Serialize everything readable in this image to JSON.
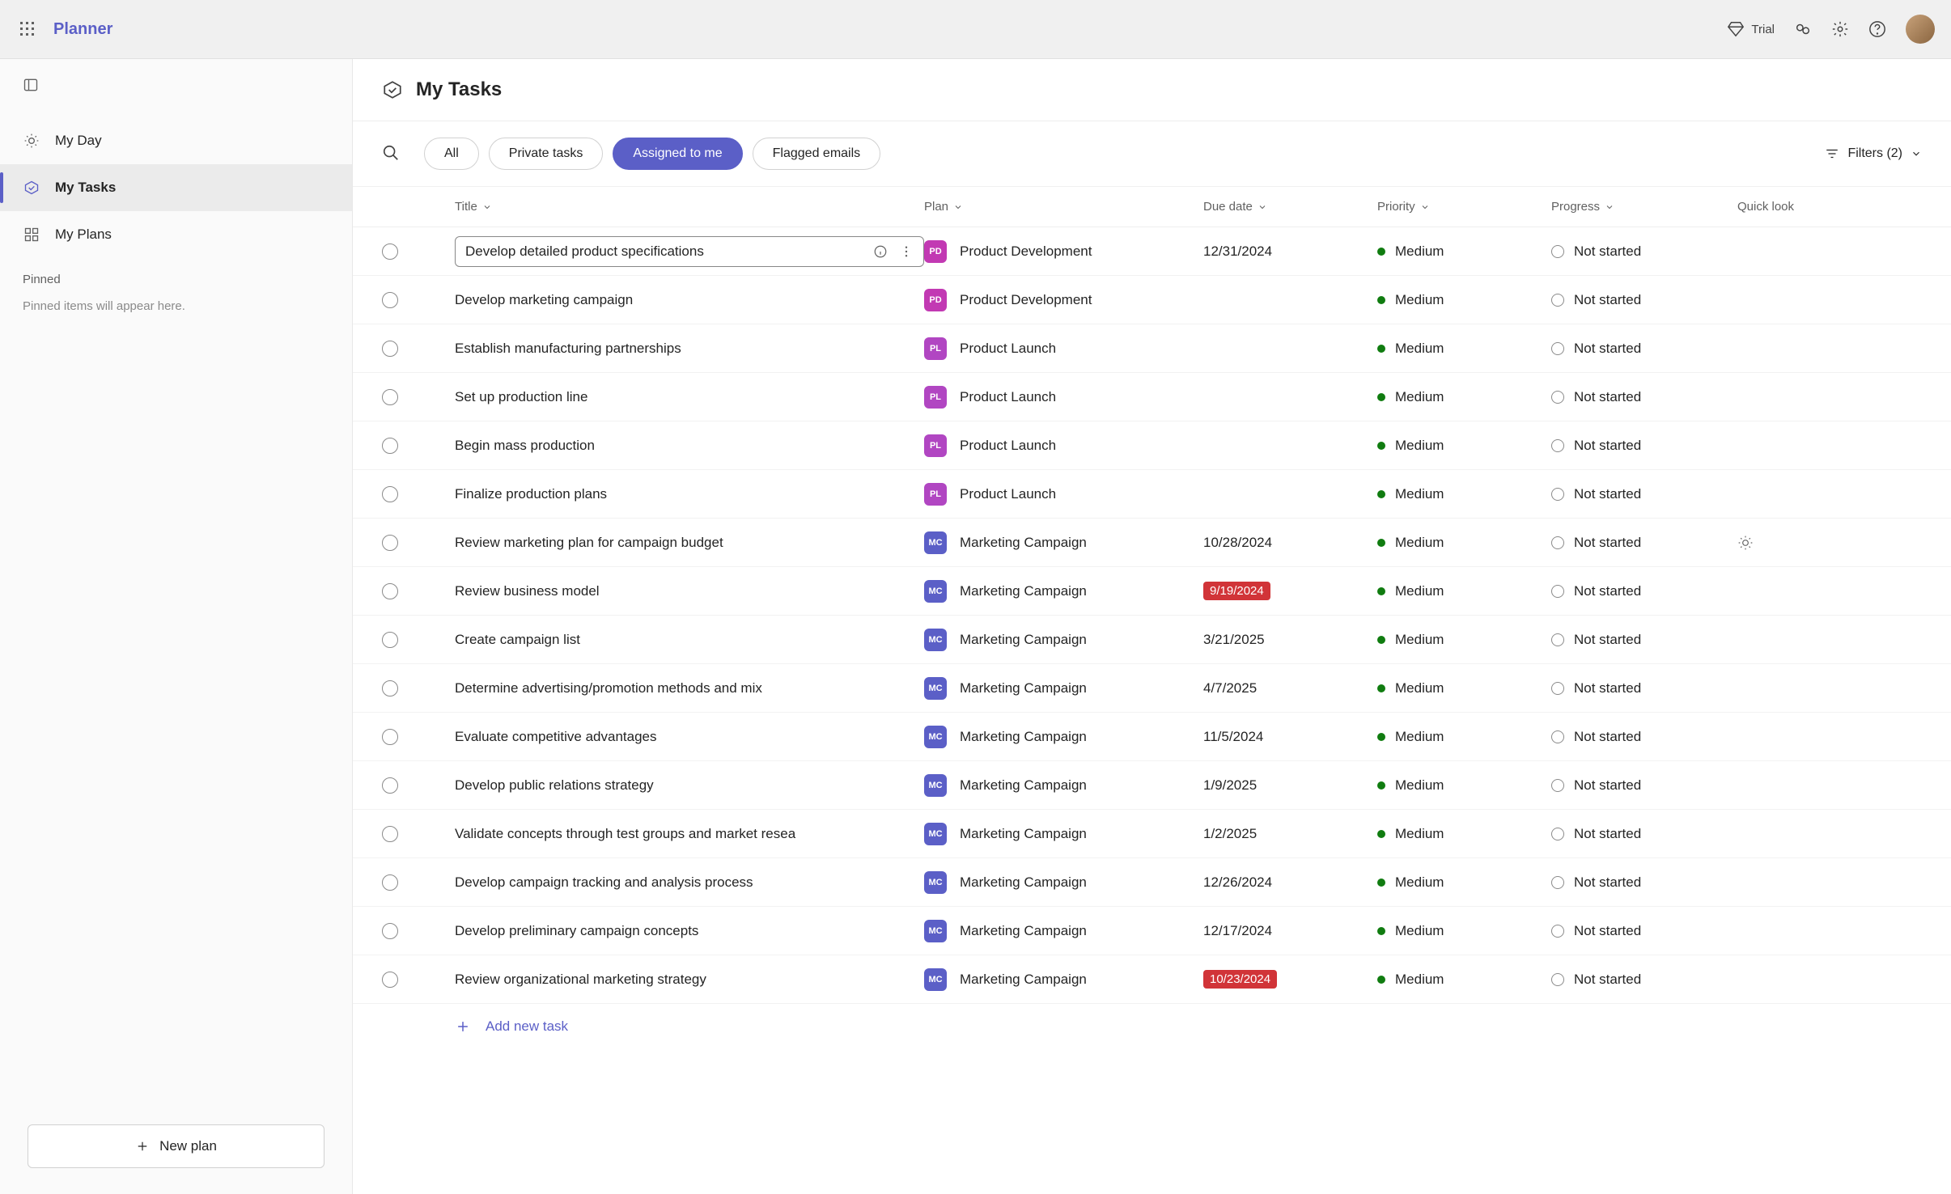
{
  "app": {
    "name": "Planner",
    "trial": "Trial"
  },
  "sidebar": {
    "myDay": "My Day",
    "myTasks": "My Tasks",
    "myPlans": "My Plans",
    "pinned": "Pinned",
    "pinnedEmpty": "Pinned items will appear here.",
    "newPlan": "New plan"
  },
  "header": {
    "title": "My Tasks"
  },
  "pills": {
    "all": "All",
    "private": "Private tasks",
    "assigned": "Assigned to me",
    "flagged": "Flagged emails"
  },
  "filters": {
    "label": "Filters (2)"
  },
  "columns": {
    "title": "Title",
    "plan": "Plan",
    "due": "Due date",
    "priority": "Priority",
    "progress": "Progress",
    "quick": "Quick look"
  },
  "addTask": "Add new task",
  "planColors": {
    "PD": "#c239b3",
    "PL": "#b146c2",
    "MC": "#5b5fc7"
  },
  "tasks": [
    {
      "title": "Develop detailed product specifications",
      "planCode": "PD",
      "planName": "Product Development",
      "due": "12/31/2024",
      "overdue": false,
      "priority": "Medium",
      "progress": "Not started",
      "selected": true
    },
    {
      "title": "Develop marketing campaign",
      "planCode": "PD",
      "planName": "Product Development",
      "due": "",
      "overdue": false,
      "priority": "Medium",
      "progress": "Not started"
    },
    {
      "title": "Establish manufacturing partnerships",
      "planCode": "PL",
      "planName": "Product Launch",
      "due": "",
      "overdue": false,
      "priority": "Medium",
      "progress": "Not started"
    },
    {
      "title": "Set up production line",
      "planCode": "PL",
      "planName": "Product Launch",
      "due": "",
      "overdue": false,
      "priority": "Medium",
      "progress": "Not started"
    },
    {
      "title": "Begin mass production",
      "planCode": "PL",
      "planName": "Product Launch",
      "due": "",
      "overdue": false,
      "priority": "Medium",
      "progress": "Not started"
    },
    {
      "title": "Finalize production plans",
      "planCode": "PL",
      "planName": "Product Launch",
      "due": "",
      "overdue": false,
      "priority": "Medium",
      "progress": "Not started"
    },
    {
      "title": "Review marketing plan for campaign budget",
      "planCode": "MC",
      "planName": "Marketing Campaign",
      "due": "10/28/2024",
      "overdue": false,
      "priority": "Medium",
      "progress": "Not started",
      "quick": true
    },
    {
      "title": "Review business model",
      "planCode": "MC",
      "planName": "Marketing Campaign",
      "due": "9/19/2024",
      "overdue": true,
      "priority": "Medium",
      "progress": "Not started"
    },
    {
      "title": "Create campaign list",
      "planCode": "MC",
      "planName": "Marketing Campaign",
      "due": "3/21/2025",
      "overdue": false,
      "priority": "Medium",
      "progress": "Not started"
    },
    {
      "title": "Determine advertising/promotion methods and mix",
      "planCode": "MC",
      "planName": "Marketing Campaign",
      "due": "4/7/2025",
      "overdue": false,
      "priority": "Medium",
      "progress": "Not started"
    },
    {
      "title": "Evaluate competitive advantages",
      "planCode": "MC",
      "planName": "Marketing Campaign",
      "due": "11/5/2024",
      "overdue": false,
      "priority": "Medium",
      "progress": "Not started"
    },
    {
      "title": "Develop public relations strategy",
      "planCode": "MC",
      "planName": "Marketing Campaign",
      "due": "1/9/2025",
      "overdue": false,
      "priority": "Medium",
      "progress": "Not started"
    },
    {
      "title": "Validate concepts through test groups and market resea",
      "planCode": "MC",
      "planName": "Marketing Campaign",
      "due": "1/2/2025",
      "overdue": false,
      "priority": "Medium",
      "progress": "Not started"
    },
    {
      "title": "Develop campaign tracking and analysis process",
      "planCode": "MC",
      "planName": "Marketing Campaign",
      "due": "12/26/2024",
      "overdue": false,
      "priority": "Medium",
      "progress": "Not started"
    },
    {
      "title": "Develop preliminary campaign concepts",
      "planCode": "MC",
      "planName": "Marketing Campaign",
      "due": "12/17/2024",
      "overdue": false,
      "priority": "Medium",
      "progress": "Not started"
    },
    {
      "title": "Review organizational marketing strategy",
      "planCode": "MC",
      "planName": "Marketing Campaign",
      "due": "10/23/2024",
      "overdue": true,
      "priority": "Medium",
      "progress": "Not started"
    }
  ]
}
